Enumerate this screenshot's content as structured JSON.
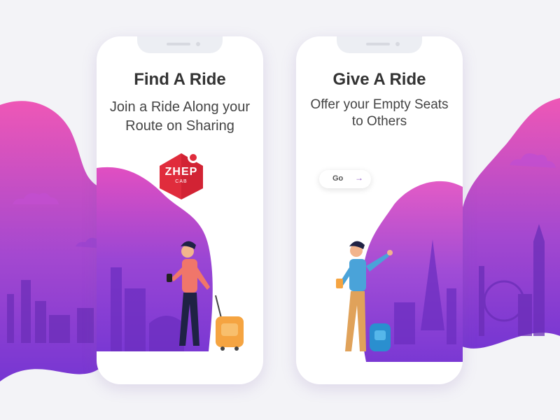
{
  "colors": {
    "background": "#f3f3f7",
    "wave_top": "#e94fb4",
    "wave_bottom": "#7d3ed7",
    "logo_red": "#e02c3c"
  },
  "phones": [
    {
      "title": "Find A Ride",
      "subtitle_lines": [
        "Join a Ride Along your",
        "Route on Sharing"
      ],
      "logo": {
        "text": "ZHEP",
        "subtext": "CAB"
      },
      "illustration": "man-with-suitcase-and-phone"
    },
    {
      "title": "Give A Ride",
      "subtitle_lines": [
        "Offer your Empty Seats",
        "to Others"
      ],
      "go_button": {
        "label": "Go",
        "icon": "arrow-right-icon"
      },
      "illustration": "man-with-backpack-waving"
    }
  ]
}
